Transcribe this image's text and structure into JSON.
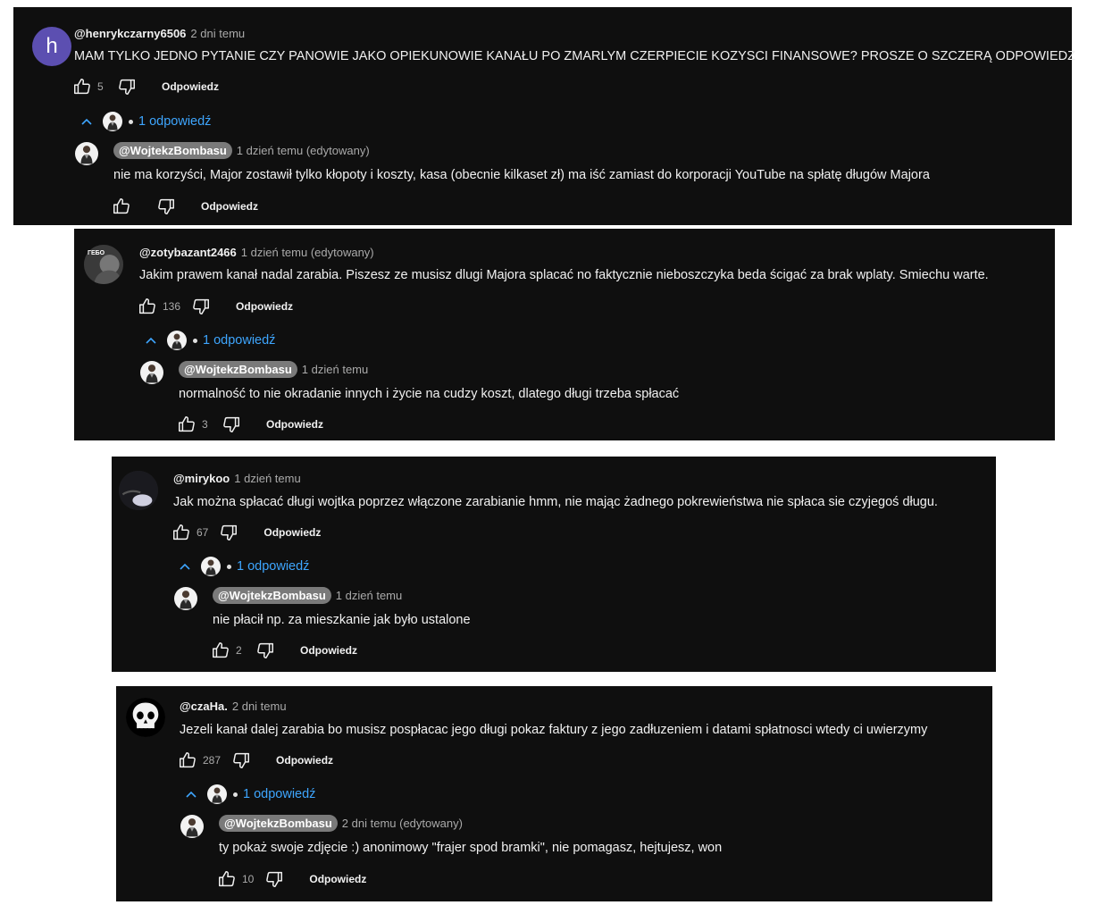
{
  "reply_label": "Odpowiedz",
  "threads": [
    {
      "comment": {
        "author": "@henrykczarny6506",
        "time": "2 dni temu",
        "avatar_letter": "h",
        "text": "MAM TYLKO JEDNO PYTANIE CZY PANOWIE JAKO OPIEKUNOWIE KANAŁU PO ZMARLYM CZERPIECIE KOZYSCI FINANSOWE? PROSZE O SZCZERĄ ODPOWIEDZ",
        "likes": "5"
      },
      "replies_toggle": "1 odpowiedź",
      "reply": {
        "author": "@WojtekzBombasu",
        "time": "1 dzień temu (edytowany)",
        "text": "nie ma korzyści, Major zostawił tylko kłopoty i koszty, kasa (obecnie kilkaset zł) ma iść zamiast do korporacji YouTube na spłatę długów Majora",
        "likes": ""
      }
    },
    {
      "comment": {
        "author": "@zotybazant2466",
        "time": "1 dzień temu (edytowany)",
        "text": "Jakim prawem kanał nadal zarabia. Piszesz ze musisz dlugi Majora splacać no faktycznie nieboszczyka beda ścigać za brak wplaty. Smiechu warte.",
        "likes": "136",
        "avatar_text": "ГЕБО"
      },
      "replies_toggle": "1 odpowiedź",
      "reply": {
        "author": "@WojtekzBombasu",
        "time": "1 dzień temu",
        "text": "normalność to nie okradanie innych i życie na cudzy koszt, dlatego długi trzeba spłacać",
        "likes": "3"
      }
    },
    {
      "comment": {
        "author": "@mirykoo",
        "time": "1 dzień temu",
        "text": "Jak można spłacać długi wojtka poprzez włączone zarabianie hmm, nie mając żadnego pokrewieństwa nie spłaca sie czyjegoś długu.",
        "likes": "67"
      },
      "replies_toggle": "1 odpowiedź",
      "reply": {
        "author": "@WojtekzBombasu",
        "time": "1 dzień temu",
        "text": "nie płacił np. za mieszkanie jak było ustalone",
        "likes": "2"
      }
    },
    {
      "comment": {
        "author": "@czaHa.",
        "time": "2 dni temu",
        "text": "Jezeli kanał dalej zarabia bo musisz pospłacac jego długi pokaz faktury z jego zadłuzeniem i datami spłatnosci wtedy ci uwierzymy",
        "likes": "287"
      },
      "replies_toggle": "1 odpowiedź",
      "reply": {
        "author": "@WojtekzBombasu",
        "time": "2 dni temu (edytowany)",
        "text": "ty pokaż swoje zdjęcie :) anonimowy \"frajer spod bramki\", nie pomagasz, hejtujesz, won",
        "likes": "10"
      }
    }
  ]
}
